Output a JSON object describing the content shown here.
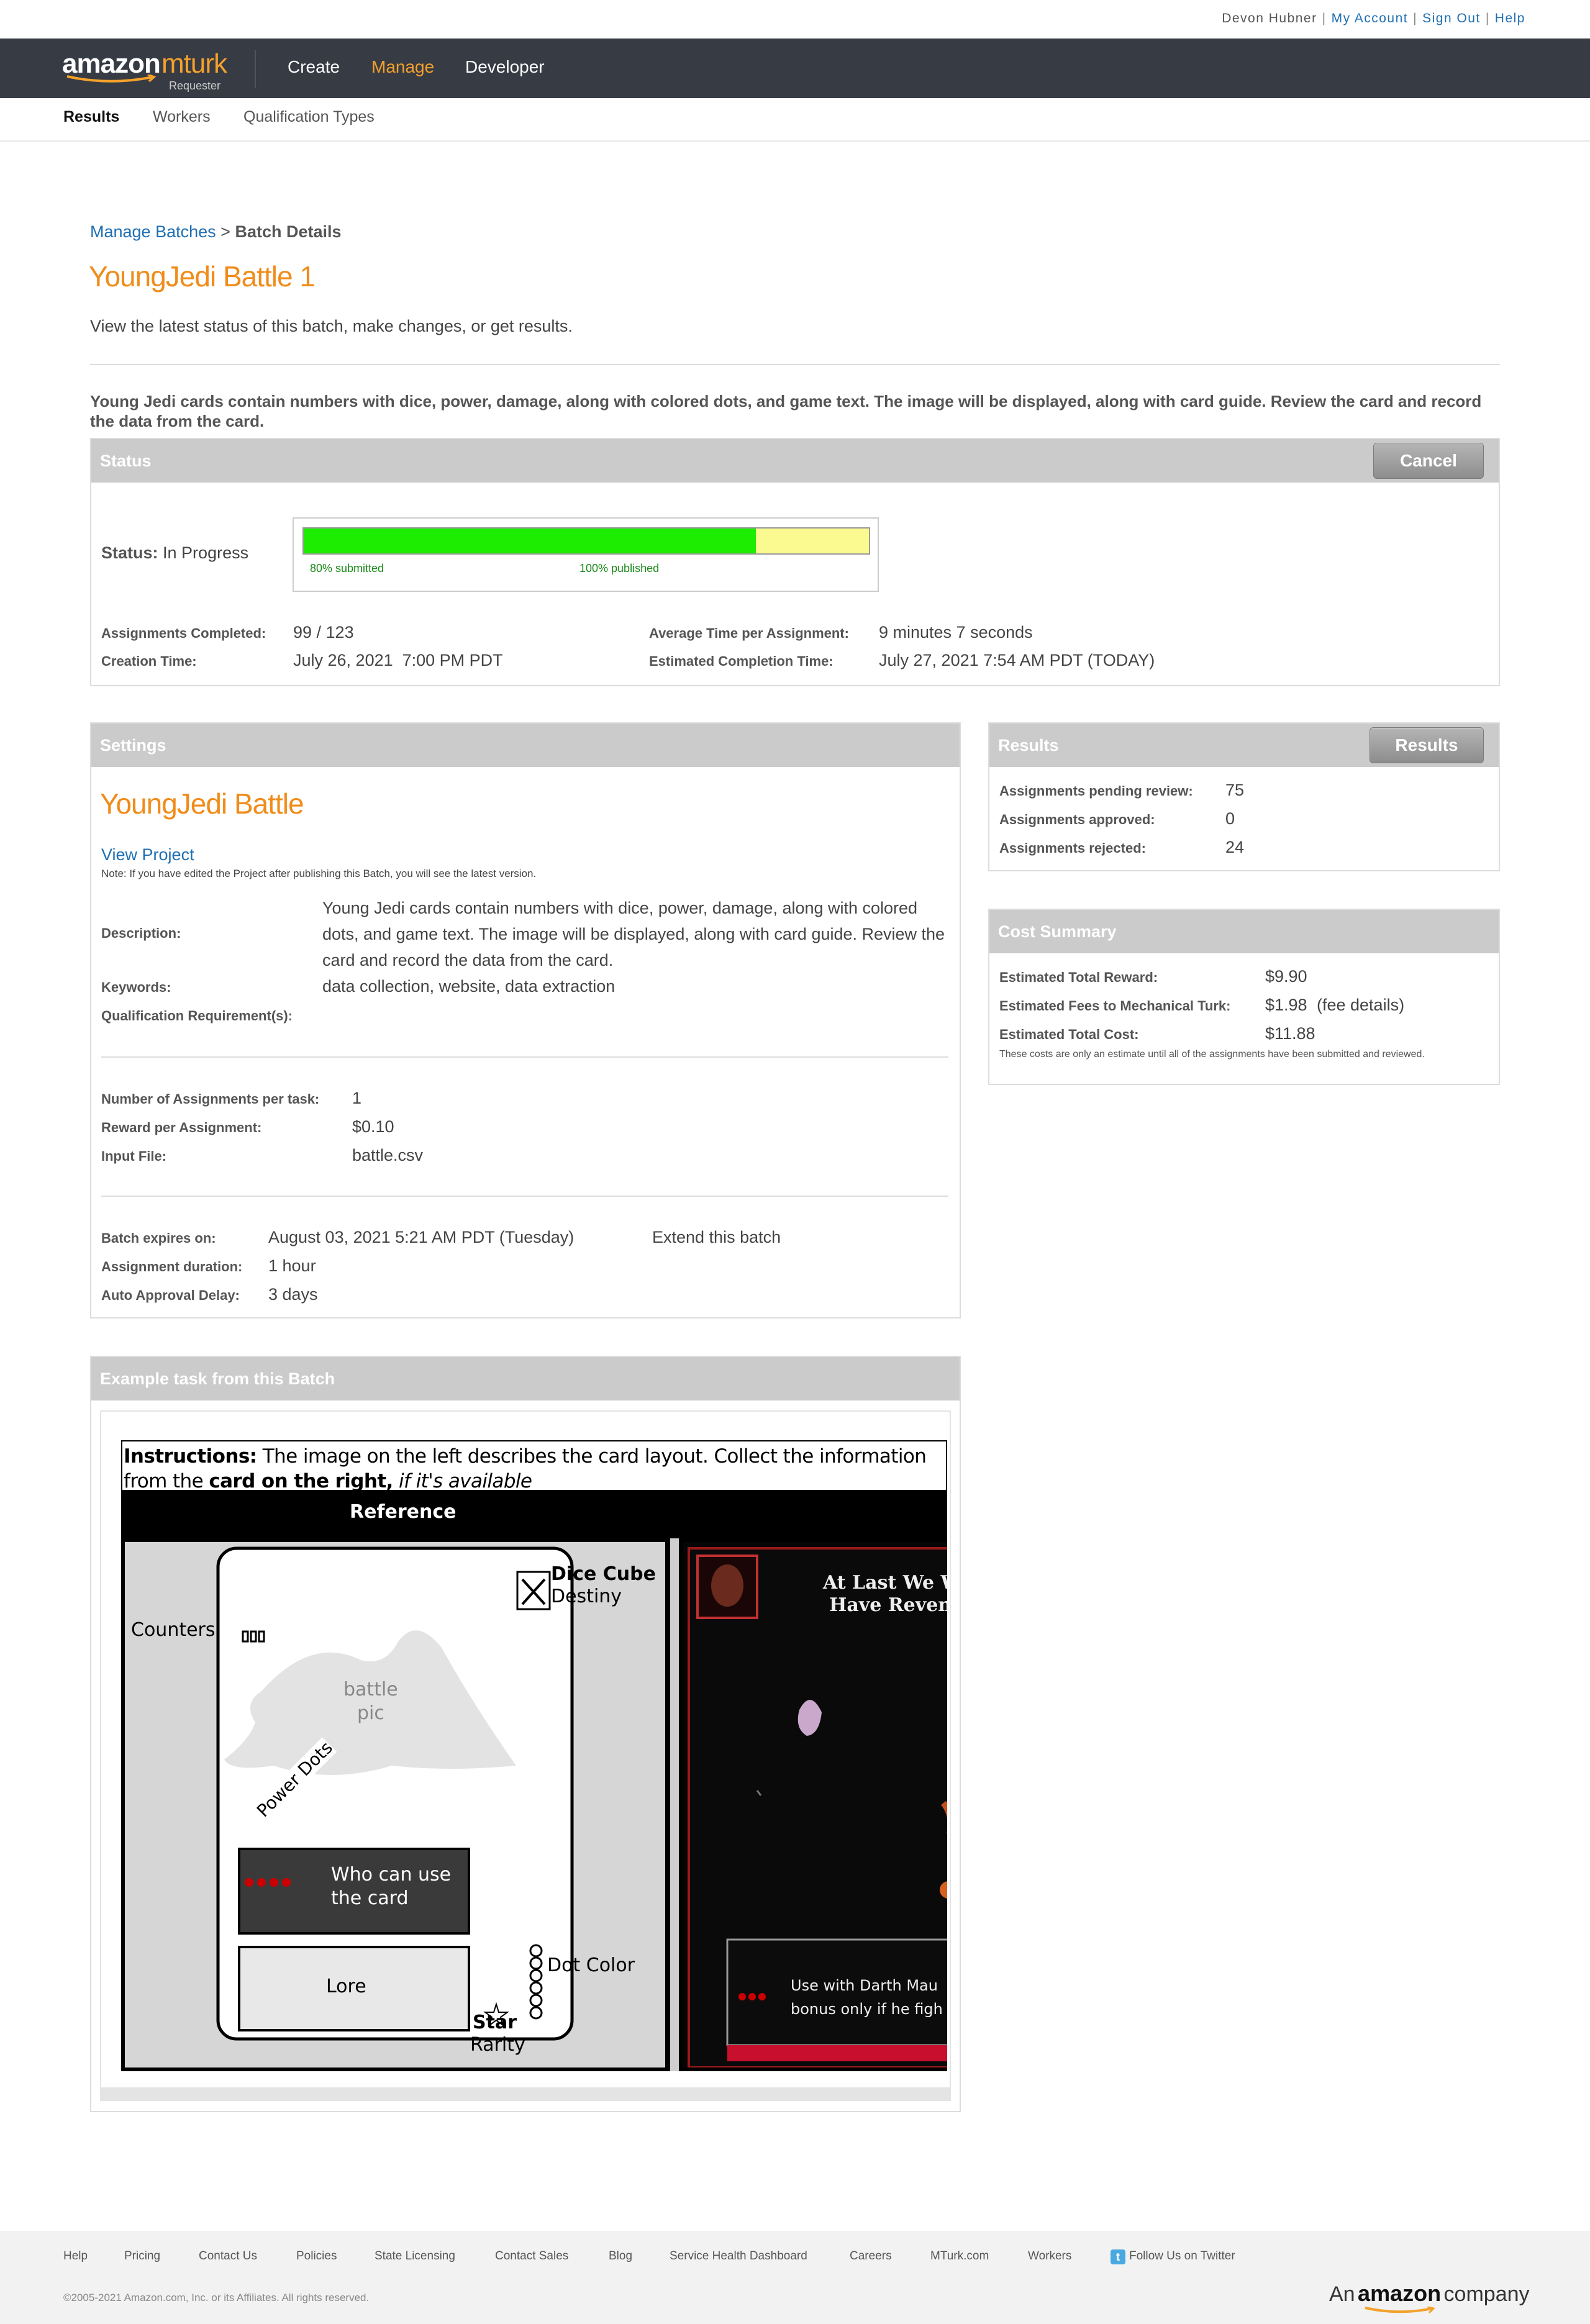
{
  "top": {
    "user": "Devon Hubner",
    "my_account": "My Account",
    "sign_out": "Sign Out",
    "help": "Help"
  },
  "nav": {
    "logo_amazon": "amazon",
    "logo_mturk": "mturk",
    "logo_requester": "Requester",
    "items": [
      "Create",
      "Manage",
      "Developer"
    ],
    "active": "Manage",
    "accent": "#f4a12b"
  },
  "subnav": {
    "items": [
      "Results",
      "Workers",
      "Qualification Types"
    ],
    "active": "Results"
  },
  "breadcrumb": {
    "link": "Manage Batches",
    "sep": ">",
    "current": "Batch Details"
  },
  "page": {
    "title": "YoungJedi Battle 1",
    "subtitle": "View the latest status of this batch, make changes, or get results.",
    "description": "Young Jedi cards contain numbers with dice, power, damage, along with colored dots, and game text. The image will be displayed, along with card guide. Review the card and record the data from the card."
  },
  "status": {
    "header": "Status",
    "cancel_label": "Cancel",
    "status_label": "Status:",
    "status_value": "In Progress",
    "submitted_fraction": 0.8,
    "published_fraction": 1.0,
    "submitted_text": "80% submitted",
    "published_text": "100% published",
    "assignments_completed_label": "Assignments Completed:",
    "assignments_completed_value": "99 / 123",
    "creation_time_label": "Creation Time:",
    "creation_time_value": "July 26, 2021  7:00 PM PDT",
    "avg_time_label": "Average Time per Assignment:",
    "avg_time_value": "9 minutes 7 seconds",
    "est_completion_label": "Estimated Completion Time:",
    "est_completion_value": "July 27, 2021 7:54 AM PDT (TODAY)"
  },
  "settings": {
    "header": "Settings",
    "project_name": "YoungJedi Battle",
    "view_project": "View Project",
    "note": "Note: If you have edited the Project after publishing this Batch, you will see the latest version.",
    "description_label": "Description:",
    "description_value": "Young Jedi cards contain numbers with dice, power, damage, along with colored dots, and game text. The image will be displayed, along with card guide. Review the card and record the data from the card.",
    "keywords_label": "Keywords:",
    "keywords_value": "data collection, website, data extraction",
    "qual_label": "Qualification Requirement(s):",
    "num_assign_label": "Number of Assignments per task:",
    "num_assign_value": "1",
    "reward_label": "Reward per Assignment:",
    "reward_value": "$0.10",
    "input_file_label": "Input File:",
    "input_file_value": "battle.csv",
    "expires_label": "Batch expires on:",
    "expires_value": "August 03, 2021 5:21 AM PDT (Tuesday)",
    "extend_label": "Extend this batch",
    "duration_label": "Assignment duration:",
    "duration_value": "1 hour",
    "auto_approval_label": "Auto Approval Delay:",
    "auto_approval_value": "3 days"
  },
  "results": {
    "header": "Results",
    "button": "Results",
    "pending_label": "Assignments pending review:",
    "pending_value": "75",
    "approved_label": "Assignments approved:",
    "approved_value": "0",
    "rejected_label": "Assignments rejected:",
    "rejected_value": "24"
  },
  "cost": {
    "header": "Cost Summary",
    "reward_label": "Estimated Total Reward:",
    "reward_value": "$9.90",
    "fees_label": "Estimated Fees to Mechanical Turk:",
    "fees_value": "$1.98",
    "fee_details": "(fee details)",
    "total_label": "Estimated Total Cost:",
    "total_value": "$11.88",
    "note": "These costs are only an estimate until all of the assignments have been submitted and reviewed."
  },
  "example": {
    "header": "Example task from this Batch",
    "instr_bold": "Instructions:",
    "instr_text": " The image on the left describes the card layout. Collect the information from the ",
    "instr_card": "card on the right,",
    "instr_ital": " if it's available",
    "reference": "Reference",
    "counters": "Counters",
    "dice_cube": "Dice Cube",
    "destiny": "Destiny",
    "battle_pic": "battle pic",
    "battle_pic_l1": "battle",
    "battle_pic_l2": "pic",
    "power_dots": "Power Dots",
    "who_l1": "Who can use",
    "who_l2": "the card",
    "lore": "Lore",
    "dot_color": "Dot Color",
    "star": "Star",
    "rarity": "Rarity",
    "card_title_l1": "At Last We W",
    "card_title_l2": "Have Reven",
    "card_text_l1": "Use with Darth Mau",
    "card_text_l2": "bonus only if he figh"
  },
  "footer": {
    "links": [
      "Help",
      "Pricing",
      "Contact Us",
      "Policies",
      "State Licensing",
      "Contact Sales",
      "Blog",
      "Service Health Dashboard",
      "Careers",
      "MTurk.com",
      "Workers",
      "Follow Us on Twitter"
    ],
    "copyright": "©2005-2021 Amazon.com, Inc. or its Affiliates. All rights reserved.",
    "company_an": "An",
    "company_amazon": "amazon",
    "company_rest": "company"
  }
}
